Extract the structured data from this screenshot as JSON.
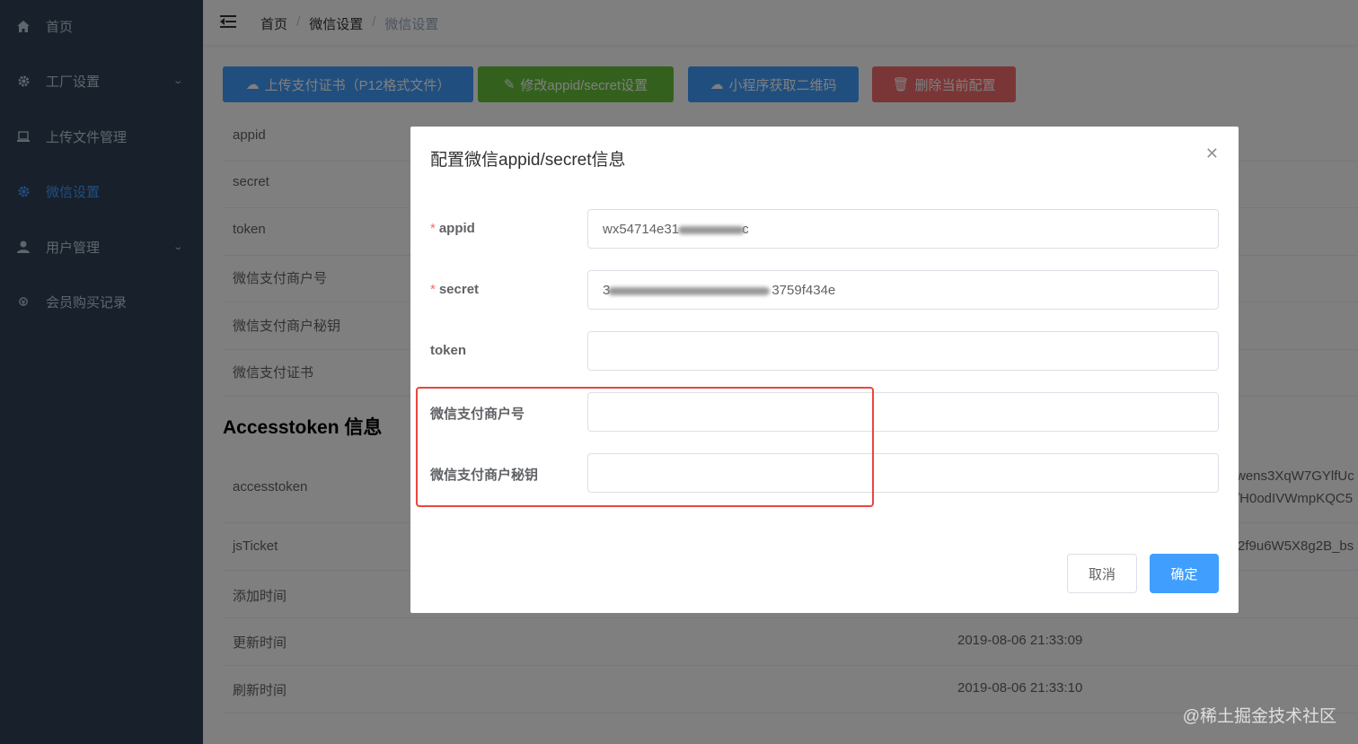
{
  "sidebar": {
    "items": [
      {
        "label": "首页",
        "icon": "home-icon"
      },
      {
        "label": "工厂设置",
        "icon": "gear-icon",
        "has_arrow": true
      },
      {
        "label": "上传文件管理",
        "icon": "file-icon"
      },
      {
        "label": "微信设置",
        "icon": "gear-icon",
        "active": true
      },
      {
        "label": "用户管理",
        "icon": "user-icon",
        "has_arrow": true
      },
      {
        "label": "会员购买记录",
        "icon": "coin-icon"
      }
    ]
  },
  "breadcrumb": [
    "首页",
    "微信设置",
    "微信设置"
  ],
  "toolbar": {
    "upload_cert": "上传支付证书（P12格式文件）",
    "edit_appid": "修改appid/secret设置",
    "get_qrcode": "小程序获取二维码",
    "delete_config": "删除当前配置"
  },
  "table": {
    "rows": [
      "appid",
      "secret",
      "token",
      "微信支付商户号",
      "微信支付商户秘钥",
      "微信支付证书"
    ],
    "section_title": "Accesstoken 信息",
    "token_rows": [
      {
        "label": "accesstoken",
        "value": ""
      },
      {
        "label": "jsTicket",
        "value": ""
      },
      {
        "label": "添加时间",
        "value": ""
      },
      {
        "label": "更新时间",
        "value": "2019-08-06 21:33:09"
      },
      {
        "label": "刷新时间",
        "value": "2019-08-06 21:33:10"
      }
    ],
    "accesstoken_partial_1": "wens3XqW7GYlfUc",
    "accesstoken_partial_2": "/H0odIVWmpKQC5",
    "jsticket_partial": "2f9u6W5X8g2B_bs"
  },
  "dialog": {
    "title": "配置微信appid/secret信息",
    "fields": {
      "appid": {
        "label": "appid",
        "value_prefix": "wx54714e31",
        "value_suffix": "c",
        "required": true
      },
      "secret": {
        "label": "secret",
        "value_prefix": "3",
        "value_suffix": "3759f434e",
        "required": true
      },
      "token": {
        "label": "token",
        "value": ""
      },
      "mch_id": {
        "label": "微信支付商户号",
        "value": ""
      },
      "mch_key": {
        "label": "微信支付商户秘钥",
        "value": ""
      }
    },
    "cancel": "取消",
    "confirm": "确定"
  },
  "watermark": "@稀土掘金技术社区",
  "colors": {
    "sidebar": "#304156",
    "primary": "#409eff",
    "success": "#67c23a",
    "danger": "#f56c6c",
    "highlight": "#e8473f"
  }
}
